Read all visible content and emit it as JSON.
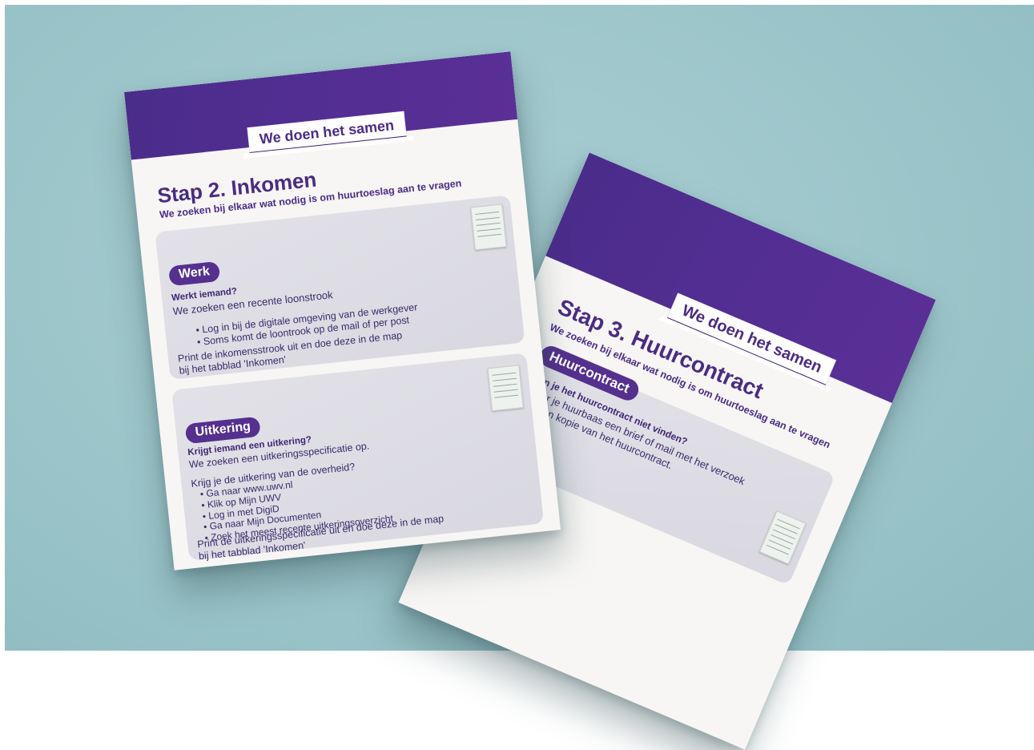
{
  "left_sheet": {
    "tag": "We doen het samen",
    "title": "Stap 2. Inkomen",
    "subtitle": "We zoeken bij elkaar wat nodig is om huurtoeslag aan te vragen",
    "werk": {
      "pill": "Werk",
      "question": "Werkt iemand?",
      "intro": "We zoeken een recente loonstrook",
      "bullets": [
        "Log in bij de digitale omgeving van de werkgever",
        "Soms komt de loontrook op de mail of per post"
      ],
      "footer_1": "Print de inkomensstrook uit en doe deze in de map",
      "footer_2": "bij het tabblad 'Inkomen'"
    },
    "uitkering": {
      "pill": "Uitkering",
      "question": "Krijgt iemand een uitkering?",
      "intro": "We zoeken een uitkeringsspecificatie op.",
      "lead": "Krijg je de uitkering van de overheid?",
      "bullets": [
        "Ga naar www.uwv.nl",
        "Klik op Mijn UWV",
        "Log in met DigiD",
        "Ga naar Mijn Documenten",
        "Zoek het meest recente uitkeringsoverzicht"
      ],
      "footer_1": "Print de uitkeringsspecificatie uit en doe deze in de map",
      "footer_2": "bij het tabblad 'Inkomen'"
    }
  },
  "right_sheet": {
    "tag": "We doen het samen",
    "title": "Stap 3. Huurcontract",
    "subtitle": "We zoeken bij elkaar wat nodig is om huurtoeslag aan te vragen",
    "card": {
      "pill": "Huurcontract",
      "question": "Kun je het huurcontract niet vinden?",
      "line_1": "Stuur je huurbaas een brief of mail met het verzoek",
      "line_2": "om een kopie van het huurcontract."
    }
  },
  "colors": {
    "background": "#9cc5ca",
    "brand_purple": "#522e92",
    "paper": "#f7f6f4",
    "card": "#dddce4"
  }
}
